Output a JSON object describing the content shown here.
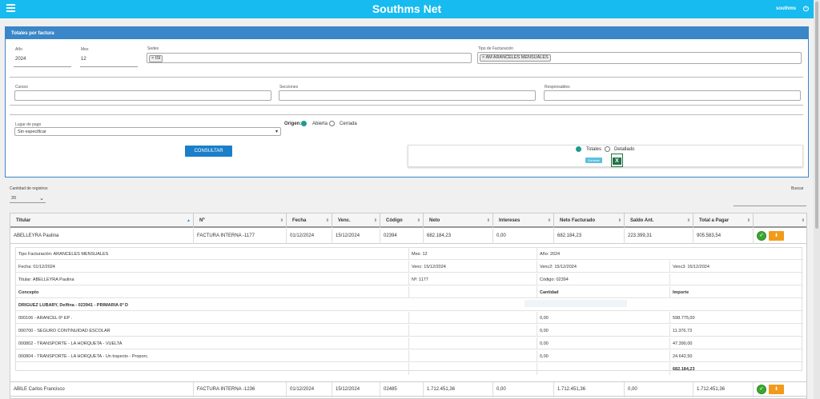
{
  "app": {
    "title": "Southms Net",
    "user": "southms"
  },
  "panel": {
    "title": "Totales por factura",
    "anio": {
      "label": "Año",
      "value": "2024"
    },
    "mes": {
      "label": "Mes",
      "value": "12"
    },
    "sedes": {
      "label": "Sedes",
      "chips": [
        "ISI"
      ]
    },
    "tipo_facturacion": {
      "label": "Tipo de Facturación",
      "chips": [
        "AM ARANCELES MENSUALES"
      ]
    },
    "cursos_label": "Cursos",
    "secciones_label": "Secciones",
    "responsables_label": "Responsables",
    "lugar_pago": {
      "label": "Lugar de pago",
      "value": "Sin especificar"
    },
    "origen": {
      "label": "Origen:",
      "options": [
        "Abierta",
        "Cerrada"
      ],
      "selected": "Abierta"
    },
    "consultar_label": "CONSULTAR",
    "export": {
      "options": [
        "Totales",
        "Detallado"
      ],
      "selected": "Totales",
      "generar_label": "Generar"
    }
  },
  "records": {
    "label": "Cantidad de registros",
    "value": "20"
  },
  "search": {
    "label": "Buscar"
  },
  "table": {
    "columns": [
      "Titular",
      "Nº",
      "Fecha",
      "Venc.",
      "Código",
      "Neto",
      "Intereses",
      "Neto Facturado",
      "Saldo Ant.",
      "Total a Pagar"
    ],
    "rows": [
      [
        "ABELLEYRA Paulina",
        "FACTURA INTERNA -1177",
        "01/12/2024",
        "15/12/2024",
        "02394",
        "682.184,23",
        "0,00",
        "682.184,23",
        "223.399,31",
        "905.583,54"
      ],
      [
        "ABILE Carlos Francisco",
        "FACTURA INTERNA -1236",
        "01/12/2024",
        "15/12/2024",
        "02485",
        "1.712.451,36",
        "0,00",
        "1.712.451,36",
        "0,00",
        "1.712.451,36"
      ]
    ]
  },
  "detail": {
    "tipo": "Tipo Facturación: ARANCELES MENSUALES",
    "mes": "Mes: 12",
    "anio": "Año: 2024",
    "fecha": "Fecha: 01/12/2024",
    "venc": "Venc: 15/12/2024",
    "venc2": "Venc2: 15/12/2024",
    "venc3": "Venc3: 15/12/2024",
    "titular": "Titular: ABELLEYRA Paulina",
    "numero": "Nº: 1177",
    "codigo": "Código: 02394",
    "h_concepto": "Concepto",
    "h_cantidad": "Cantidad",
    "h_importe": "Importe",
    "alumno": "DRIGUEZ LUBARY, Delfina - 023941 - PRIMARIA 6º D",
    "items": [
      {
        "concepto": "000106 - ARANCEL 6º EP .",
        "cantidad": "0,00",
        "importe": "598.775,00"
      },
      {
        "concepto": "000700 - SEGURO CONTINUIDAD ESCOLAR",
        "cantidad": "0,00",
        "importe": "11.376,73"
      },
      {
        "concepto": "000802 - TRANSPORTE - LA HORQUETA - VUELTA",
        "cantidad": "0,00",
        "importe": "47.390,00"
      },
      {
        "concepto": "000804 - TRANSPORTE - LA HORQUETA - Un trayecto - Proporc.",
        "cantidad": "0,00",
        "importe": "24.642,50"
      }
    ],
    "total": "682.184,23"
  },
  "colors": {
    "topbar": "#17bbf0",
    "panel_header": "#3a86c8",
    "button": "#1a7fc8",
    "ok": "#3aa830",
    "download": "#f29a1a"
  }
}
